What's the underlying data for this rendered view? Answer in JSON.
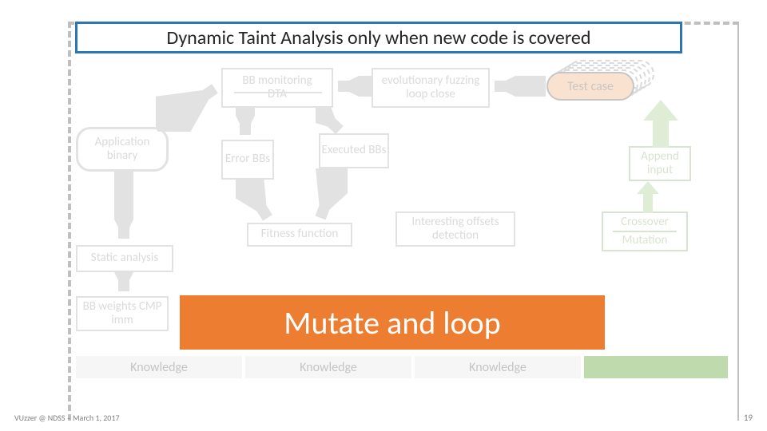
{
  "title": "Dynamic Taint Analysis only when new code is covered",
  "boxes": {
    "bb_monitoring": "BB monitoring",
    "dta": "DTA",
    "evo_fuzzing": "evolutionary fuzzing loop close",
    "test_case": "Test case",
    "app_binary": "Application binary",
    "error_bbs": "Error BBs",
    "executed_bbs": "Executed BBs",
    "append_input": "Append input",
    "static_analysis": "Static analysis",
    "fitness_function": "Fitness function",
    "interesting_offsets": "Interesting offsets detection",
    "crossover": "Crossover",
    "mutation": "Mutation",
    "bb_weights": "BB weights CMP imm",
    "knowledge": "Knowledge"
  },
  "overlay": "Mutate and loop",
  "footer": "VUzzer @ NDSS – March 1, 2017",
  "page_number": "19"
}
